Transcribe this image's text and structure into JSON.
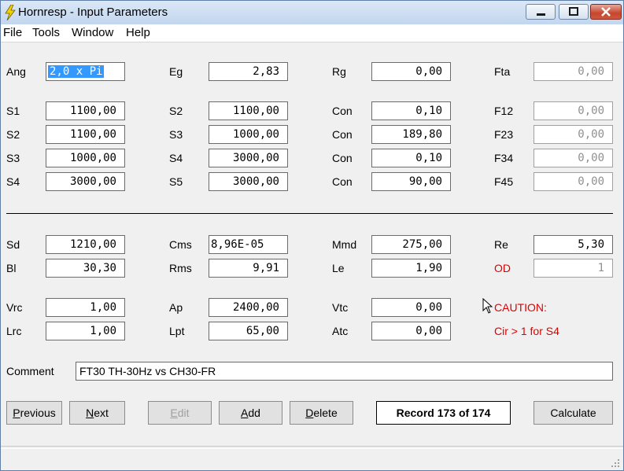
{
  "window": {
    "title": "Hornresp - Input Parameters"
  },
  "menu": [
    "File",
    "Tools",
    "Window",
    "Help"
  ],
  "top_section": [
    {
      "label": "Ang",
      "value": "2,0 x Pi",
      "selected": true
    },
    {
      "label": "Eg",
      "value": "2,83"
    },
    {
      "label": "Rg",
      "value": "0,00"
    },
    {
      "label": "Fta",
      "value": "0,00",
      "readonly": true
    },
    {
      "label": "S1",
      "value": "1100,00"
    },
    {
      "label": "S2",
      "value": "1100,00"
    },
    {
      "label": "Con",
      "value": "0,10"
    },
    {
      "label": "F12",
      "value": "0,00",
      "readonly": true
    },
    {
      "label": "S2",
      "value": "1100,00"
    },
    {
      "label": "S3",
      "value": "1000,00"
    },
    {
      "label": "Con",
      "value": "189,80"
    },
    {
      "label": "F23",
      "value": "0,00",
      "readonly": true
    },
    {
      "label": "S3",
      "value": "1000,00"
    },
    {
      "label": "S4",
      "value": "3000,00"
    },
    {
      "label": "Con",
      "value": "0,10"
    },
    {
      "label": "F34",
      "value": "0,00",
      "readonly": true
    },
    {
      "label": "S4",
      "value": "3000,00"
    },
    {
      "label": "S5",
      "value": "3000,00"
    },
    {
      "label": "Con",
      "value": "90,00"
    },
    {
      "label": "F45",
      "value": "0,00",
      "readonly": true
    }
  ],
  "driver_section": [
    {
      "label": "Sd",
      "value": "1210,00"
    },
    {
      "label": "Cms",
      "value": "8,96E-05"
    },
    {
      "label": "Mmd",
      "value": "275,00"
    },
    {
      "label": "Re",
      "value": "5,30"
    },
    {
      "label": "Bl",
      "value": "30,30"
    },
    {
      "label": "Rms",
      "value": "9,91"
    },
    {
      "label": "Le",
      "value": "1,90"
    },
    {
      "label": "OD",
      "value": "1",
      "readonly": true,
      "red": true
    },
    {
      "label": "Vrc",
      "value": "1,00"
    },
    {
      "label": "Ap",
      "value": "2400,00"
    },
    {
      "label": "Vtc",
      "value": "0,00"
    },
    {
      "label": "Lrc",
      "value": "1,00"
    },
    {
      "label": "Lpt",
      "value": "65,00"
    },
    {
      "label": "Atc",
      "value": "0,00"
    }
  ],
  "caution": {
    "title": "CAUTION:",
    "message": "Cir > 1 for S4"
  },
  "comment": {
    "label": "Comment",
    "value": "FT30 TH-30Hz vs CH30-FR"
  },
  "buttons": {
    "previous": "Previous",
    "next": "Next",
    "edit": "Edit",
    "add": "Add",
    "delete": "Delete",
    "calculate": "Calculate"
  },
  "record": "Record 173 of 174",
  "colors": {
    "accent": "#3399ff",
    "warning": "#e00000"
  }
}
